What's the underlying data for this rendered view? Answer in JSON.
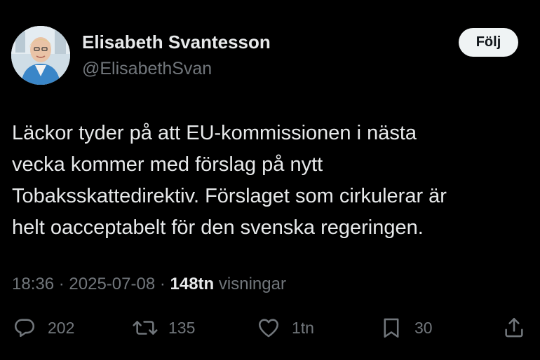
{
  "user": {
    "display_name": "Elisabeth Svantesson",
    "handle": "@ElisabethSvan",
    "follow_label": "Följ"
  },
  "tweet": {
    "text_lines": [
      "Läckor tyder på att EU-kommissionen i nästa",
      "vecka kommer med förslag på nytt",
      "Tobaksskattedirektiv. Förslaget som cirkulerar är",
      "helt oacceptabelt för den svenska regeringen."
    ]
  },
  "meta": {
    "time": "18:36",
    "separator": "·",
    "date": "2025-07-08",
    "views_count": "148tn",
    "views_label": "visningar"
  },
  "actions": {
    "replies": "202",
    "reposts": "135",
    "likes": "1tn",
    "bookmarks": "30"
  },
  "icons": {
    "reply": "speech-bubble-icon",
    "repost": "repost-arrows-icon",
    "like": "heart-icon",
    "bookmark": "bookmark-icon",
    "share": "share-icon"
  },
  "colors": {
    "background": "#000000",
    "primary_text": "#e7e9ea",
    "secondary_text": "#71767b",
    "follow_button_bg": "#eff3f4",
    "follow_button_text": "#0f1419"
  }
}
